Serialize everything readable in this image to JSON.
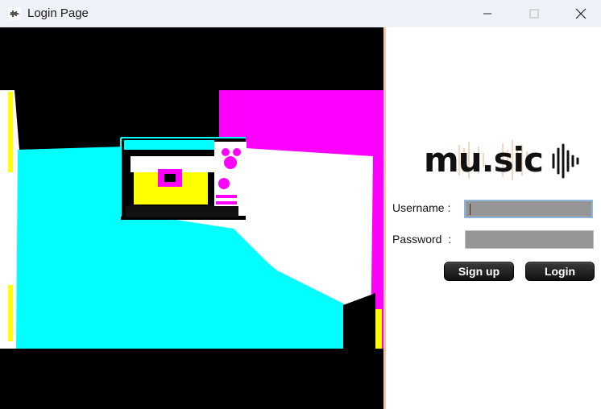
{
  "window": {
    "title": "Login Page"
  },
  "logo": {
    "text": "mu.sic"
  },
  "form": {
    "username_label": "Username :",
    "password_label": "Password  :",
    "username_value": "",
    "password_value": ""
  },
  "buttons": {
    "signup_label": "Sign up",
    "login_label": "Login"
  },
  "colors": {
    "titlebar": "#eef2f8",
    "divider": "#f4c6a5",
    "field_bg": "#969696",
    "button_bg": "#1f1f1f"
  }
}
